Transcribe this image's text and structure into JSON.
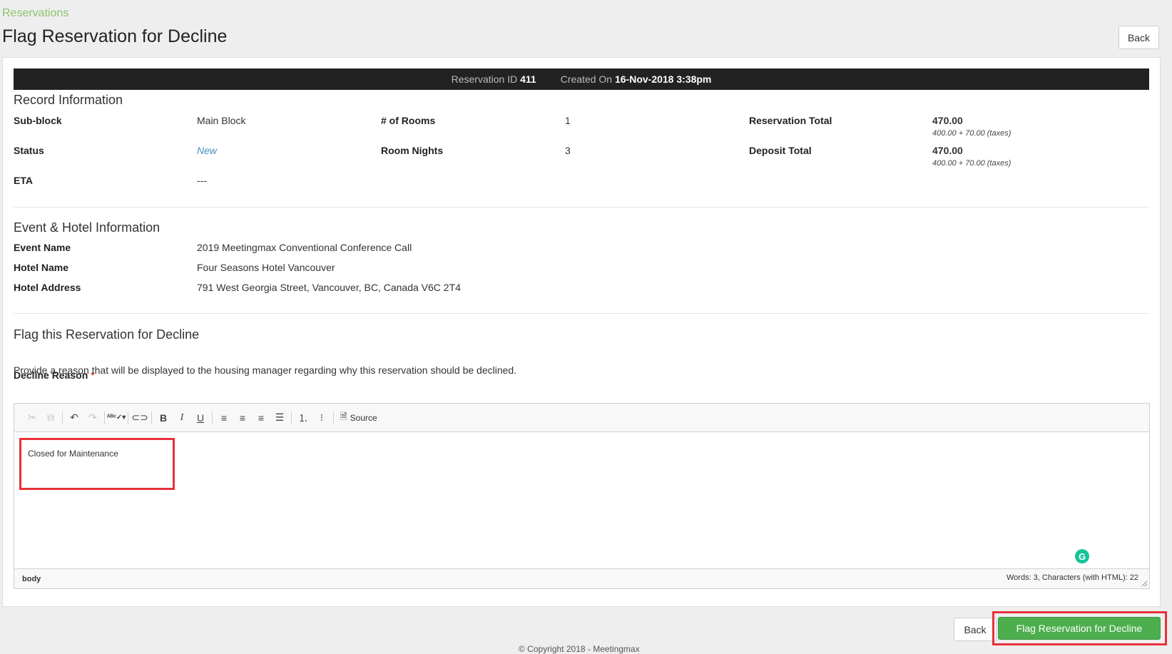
{
  "breadcrumb": "Reservations",
  "title": "Flag Reservation for Decline",
  "back_label": "Back",
  "summary": {
    "id_label": "Reservation ID",
    "id_value": "411",
    "created_label": "Created On",
    "created_value": "16-Nov-2018 3:38pm"
  },
  "record": {
    "heading": "Record Information",
    "subblock_label": "Sub-block",
    "subblock_value": "Main Block",
    "status_label": "Status",
    "status_value": "New",
    "eta_label": "ETA",
    "eta_value": "---",
    "rooms_label": "# of Rooms",
    "rooms_value": "1",
    "nights_label": "Room Nights",
    "nights_value": "3",
    "res_total_label": "Reservation Total",
    "res_total_value": "470.00",
    "res_total_breakdown": "400.00 + 70.00 (taxes)",
    "deposit_label": "Deposit Total",
    "deposit_value": "470.00",
    "deposit_breakdown": "400.00 + 70.00 (taxes)"
  },
  "event": {
    "heading": "Event & Hotel Information",
    "event_label": "Event Name",
    "event_value": "2019 Meetingmax Conventional Conference Call",
    "hotel_label": "Hotel Name",
    "hotel_value": "Four Seasons Hotel Vancouver",
    "address_label": "Hotel Address",
    "address_value": "791 West Georgia Street, Vancouver, BC, Canada V6C 2T4"
  },
  "decline": {
    "heading": "Flag this Reservation for Decline",
    "hint": "Provide a reason that will be displayed to the housing manager regarding why this reservation should be declined.",
    "reason_label": "Decline Reason",
    "required_mark": "*",
    "source_label": "Source",
    "content": "Closed for Maintenance",
    "path": "body",
    "counts": "Words: 3, Characters (with HTML): 22"
  },
  "toolbar_icons": [
    "cut-icon",
    "copy-icon",
    "undo-icon",
    "redo-icon",
    "spellcheck-icon",
    "link-icon",
    "bold-icon",
    "italic-icon",
    "underline-icon",
    "align-left-icon",
    "align-center-icon",
    "align-right-icon",
    "justify-icon",
    "numbered-list-icon",
    "bulleted-list-icon",
    "source-icon"
  ],
  "flag_button": "Flag Reservation for Decline",
  "footer": "© Copyright 2018 - Meetingmax",
  "colors": {
    "accent_green": "#4cae4c",
    "breadcrumb_green": "#8dc26f",
    "highlight_red": "#e8313a",
    "link_blue": "#4a90c2"
  }
}
